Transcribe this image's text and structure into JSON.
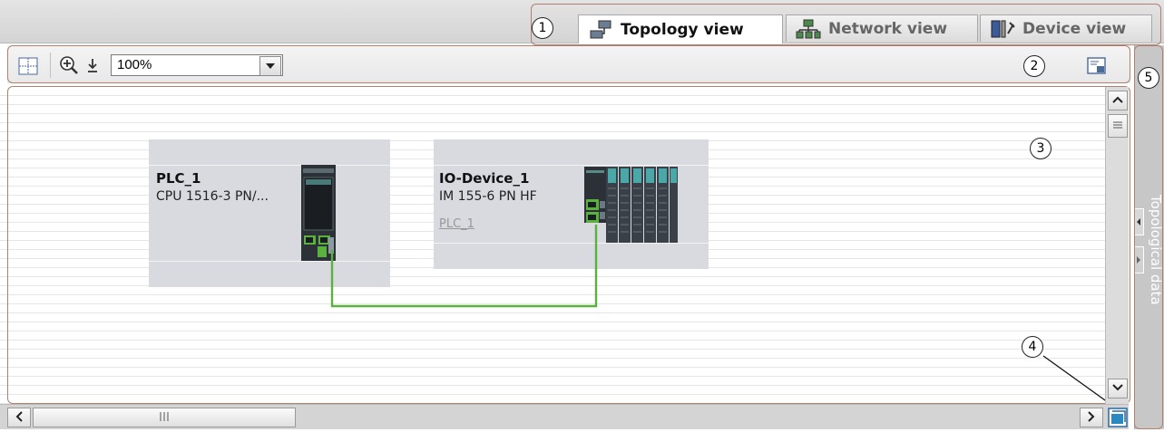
{
  "tabs": [
    {
      "label": "Topology view",
      "icon": "topology-icon",
      "active": true
    },
    {
      "label": "Network view",
      "icon": "network-icon",
      "active": false
    },
    {
      "label": "Device view",
      "icon": "device-icon",
      "active": false
    }
  ],
  "toolbar": {
    "zoom_value": "100%"
  },
  "devices": [
    {
      "name": "PLC_1",
      "type": "CPU 1516-3 PN/...",
      "link": ""
    },
    {
      "name": "IO-Device_1",
      "type": "IM 155-6 PN HF",
      "link": "PLC_1"
    }
  ],
  "side_panel": {
    "label": "Topological data"
  },
  "callouts": [
    "1",
    "2",
    "3",
    "4",
    "5"
  ],
  "colors": {
    "connection": "#5ab13e",
    "frame": "#b08070",
    "device_bg": "#d9dae0",
    "module_teal": "#4aa8a8"
  }
}
